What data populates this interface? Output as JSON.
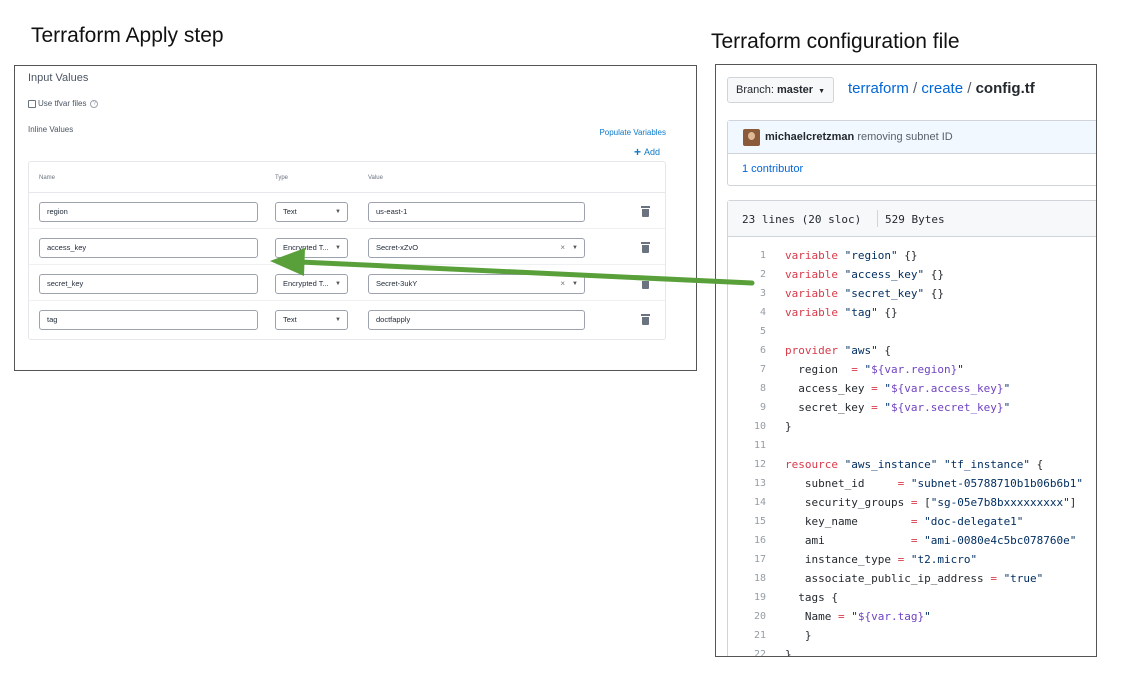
{
  "captions": {
    "left": "Terraform Apply step",
    "right": "Terraform configuration file"
  },
  "input_values": {
    "title": "Input Values",
    "use_tfvar_label": "Use tfvar files",
    "use_tfvar_checked": false,
    "inline_label": "Inline Values",
    "populate_label": "Populate Variables",
    "add_label": "Add",
    "columns": {
      "name": "Name",
      "type": "Type",
      "value": "Value"
    },
    "rows": [
      {
        "name": "region",
        "type": "Text",
        "value": "us-east-1",
        "clearable": false
      },
      {
        "name": "access_key",
        "type": "Encrypted T...",
        "value": "Secret-xZvO",
        "clearable": true
      },
      {
        "name": "secret_key",
        "type": "Encrypted T...",
        "value": "Secret-3ukY",
        "clearable": true
      },
      {
        "name": "tag",
        "type": "Text",
        "value": "doctfapply",
        "clearable": false
      }
    ]
  },
  "repo": {
    "branch_label": "Branch:",
    "branch_name": "master",
    "path": [
      "terraform",
      "create"
    ],
    "file": "config.tf",
    "commit_author": "michaelcretzman",
    "commit_message": "removing subnet ID",
    "contributors": "1 contributor",
    "file_lines": "23 lines (20 sloc)",
    "file_size": "529 Bytes",
    "code_lines": [
      [
        {
          "t": "kw",
          "v": "variable"
        },
        {
          "t": "p",
          "v": " "
        },
        {
          "t": "st",
          "v": "\"region\""
        },
        {
          "t": "p",
          "v": " {}"
        }
      ],
      [
        {
          "t": "kw",
          "v": "variable"
        },
        {
          "t": "p",
          "v": " "
        },
        {
          "t": "st",
          "v": "\"access_key\""
        },
        {
          "t": "p",
          "v": " {}"
        }
      ],
      [
        {
          "t": "kw",
          "v": "variable"
        },
        {
          "t": "p",
          "v": " "
        },
        {
          "t": "st",
          "v": "\"secret_key\""
        },
        {
          "t": "p",
          "v": " {}"
        }
      ],
      [
        {
          "t": "kw",
          "v": "variable"
        },
        {
          "t": "p",
          "v": " "
        },
        {
          "t": "st",
          "v": "\"tag\""
        },
        {
          "t": "p",
          "v": " {}"
        }
      ],
      [],
      [
        {
          "t": "kw",
          "v": "provider"
        },
        {
          "t": "p",
          "v": " "
        },
        {
          "t": "st",
          "v": "\"aws\""
        },
        {
          "t": "p",
          "v": " {"
        }
      ],
      [
        {
          "t": "p",
          "v": "  region  "
        },
        {
          "t": "kw",
          "v": "="
        },
        {
          "t": "p",
          "v": " "
        },
        {
          "t": "st",
          "v": "\""
        },
        {
          "t": "iv",
          "v": "${var.region}"
        },
        {
          "t": "st",
          "v": "\""
        }
      ],
      [
        {
          "t": "p",
          "v": "  access_key "
        },
        {
          "t": "kw",
          "v": "="
        },
        {
          "t": "p",
          "v": " "
        },
        {
          "t": "st",
          "v": "\""
        },
        {
          "t": "iv",
          "v": "${var.access_key}"
        },
        {
          "t": "st",
          "v": "\""
        }
      ],
      [
        {
          "t": "p",
          "v": "  secret_key "
        },
        {
          "t": "kw",
          "v": "="
        },
        {
          "t": "p",
          "v": " "
        },
        {
          "t": "st",
          "v": "\""
        },
        {
          "t": "iv",
          "v": "${var.secret_key}"
        },
        {
          "t": "st",
          "v": "\""
        }
      ],
      [
        {
          "t": "p",
          "v": "}"
        }
      ],
      [],
      [
        {
          "t": "kw",
          "v": "resource"
        },
        {
          "t": "p",
          "v": " "
        },
        {
          "t": "st",
          "v": "\"aws_instance\""
        },
        {
          "t": "p",
          "v": " "
        },
        {
          "t": "st",
          "v": "\"tf_instance\""
        },
        {
          "t": "p",
          "v": " {"
        }
      ],
      [
        {
          "t": "p",
          "v": "   subnet_id     "
        },
        {
          "t": "kw",
          "v": "="
        },
        {
          "t": "p",
          "v": " "
        },
        {
          "t": "st",
          "v": "\"subnet-05788710b1b06b6b1\""
        }
      ],
      [
        {
          "t": "p",
          "v": "   security_groups "
        },
        {
          "t": "kw",
          "v": "="
        },
        {
          "t": "p",
          "v": " ["
        },
        {
          "t": "st",
          "v": "\"sg-05e7b8bxxxxxxxxx\""
        },
        {
          "t": "p",
          "v": "]"
        }
      ],
      [
        {
          "t": "p",
          "v": "   key_name        "
        },
        {
          "t": "kw",
          "v": "="
        },
        {
          "t": "p",
          "v": " "
        },
        {
          "t": "st",
          "v": "\"doc-delegate1\""
        }
      ],
      [
        {
          "t": "p",
          "v": "   ami             "
        },
        {
          "t": "kw",
          "v": "="
        },
        {
          "t": "p",
          "v": " "
        },
        {
          "t": "st",
          "v": "\"ami-0080e4c5bc078760e\""
        }
      ],
      [
        {
          "t": "p",
          "v": "   instance_type "
        },
        {
          "t": "kw",
          "v": "="
        },
        {
          "t": "p",
          "v": " "
        },
        {
          "t": "st",
          "v": "\"t2.micro\""
        }
      ],
      [
        {
          "t": "p",
          "v": "   associate_public_ip_address "
        },
        {
          "t": "kw",
          "v": "="
        },
        {
          "t": "p",
          "v": " "
        },
        {
          "t": "st",
          "v": "\"true\""
        }
      ],
      [
        {
          "t": "p",
          "v": "  tags {"
        }
      ],
      [
        {
          "t": "p",
          "v": "   Name "
        },
        {
          "t": "kw",
          "v": "="
        },
        {
          "t": "p",
          "v": " "
        },
        {
          "t": "st",
          "v": "\""
        },
        {
          "t": "iv",
          "v": "${var.tag}"
        },
        {
          "t": "st",
          "v": "\""
        }
      ],
      [
        {
          "t": "p",
          "v": "   }"
        }
      ],
      [
        {
          "t": "p",
          "v": "}"
        }
      ]
    ]
  },
  "colors": {
    "link": "#0366d6",
    "keyword": "#d73a49",
    "string": "#032f62",
    "interpolation": "#6f42c1",
    "arrow": "#5aa03a"
  },
  "icons": {
    "trash": "trash-icon",
    "clear": "clear-icon",
    "dropdown": "chevron-down-icon",
    "help": "help-icon",
    "add": "plus-icon"
  }
}
